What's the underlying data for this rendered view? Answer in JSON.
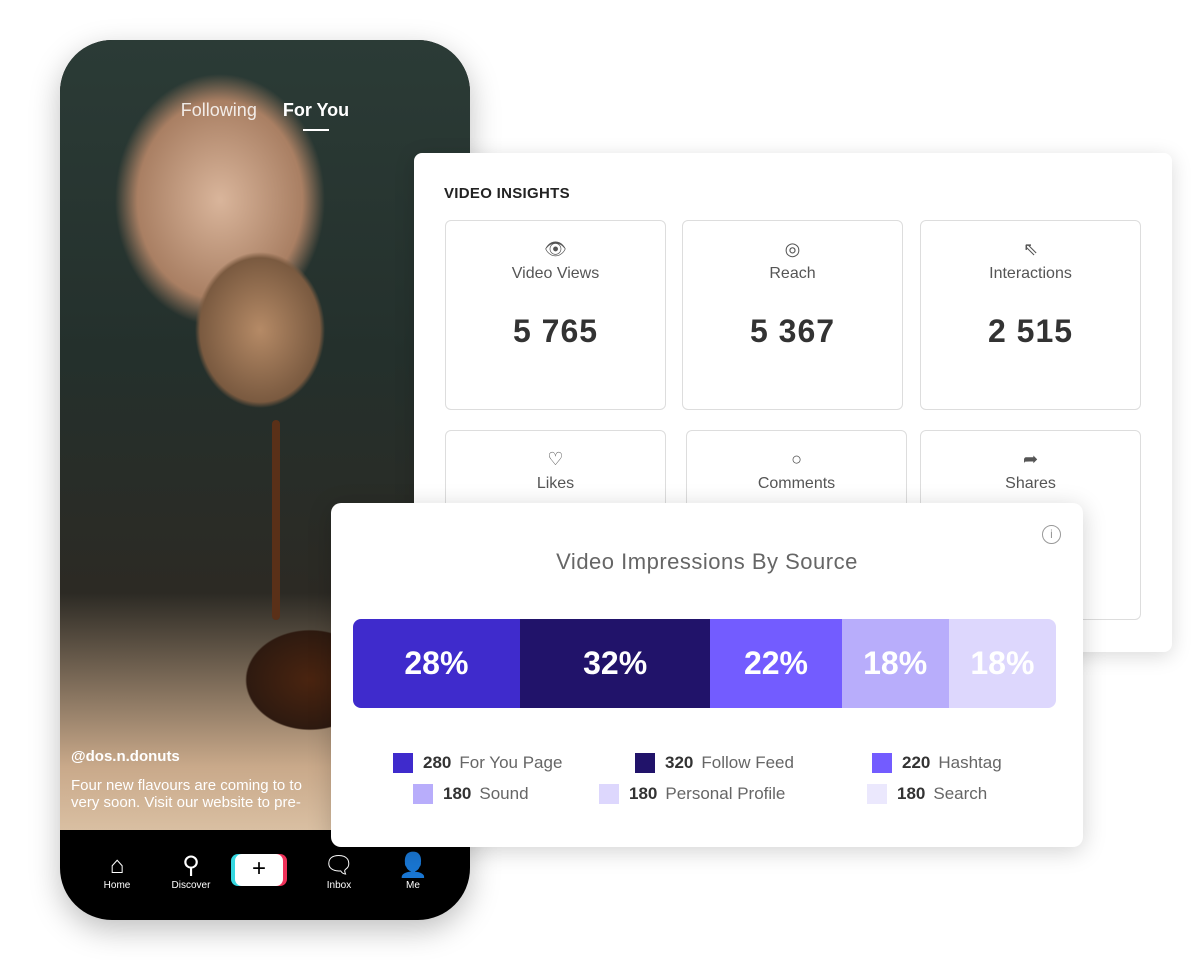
{
  "phone": {
    "tabs": [
      "Following",
      "For You"
    ],
    "active_tab": "For You",
    "username": "@dos.n.donuts",
    "caption_line1": "Four new flavours are coming to to",
    "caption_line2": "very soon. Visit our website to pre-",
    "nav": [
      {
        "label": "Home",
        "icon": "home-icon"
      },
      {
        "label": "Discover",
        "icon": "search-icon"
      },
      {
        "label": "",
        "icon": "plus-icon"
      },
      {
        "label": "Inbox",
        "icon": "inbox-icon"
      },
      {
        "label": "Me",
        "icon": "profile-icon"
      }
    ]
  },
  "insights": {
    "title": "VIDEO INSIGHTS",
    "tiles": [
      {
        "label": "Video Views",
        "value": "5 765",
        "icon": "eye-icon"
      },
      {
        "label": "Reach",
        "value": "5 367",
        "icon": "target-icon"
      },
      {
        "label": "Interactions",
        "value": "2 515",
        "icon": "cursor-click-icon"
      },
      {
        "label": "Likes",
        "icon": "heart-icon"
      },
      {
        "label": "Comments",
        "icon": "comment-icon"
      },
      {
        "label": "Shares",
        "icon": "share-icon"
      }
    ]
  },
  "chart_data": {
    "type": "bar",
    "title": "Video Impressions By Source",
    "stacked": true,
    "segments": [
      {
        "name": "For You Page",
        "value": 280,
        "percent": "28%",
        "pct": 28,
        "color": "#3f2bcc"
      },
      {
        "name": "Follow Feed",
        "value": 320,
        "percent": "32%",
        "pct": 32,
        "color": "#21136a"
      },
      {
        "name": "Hashtag",
        "value": 220,
        "percent": "22%",
        "pct": 22,
        "color": "#735cff"
      },
      {
        "name": "Sound",
        "value": 180,
        "percent": "18%",
        "pct": 18,
        "color": "#b8adfb"
      },
      {
        "name": "Personal Profile",
        "value": 180,
        "percent": "18%",
        "pct": 18,
        "color": "#ddd7fd"
      },
      {
        "name": "Search",
        "value": 180,
        "color": "#ebe8fd"
      }
    ]
  }
}
